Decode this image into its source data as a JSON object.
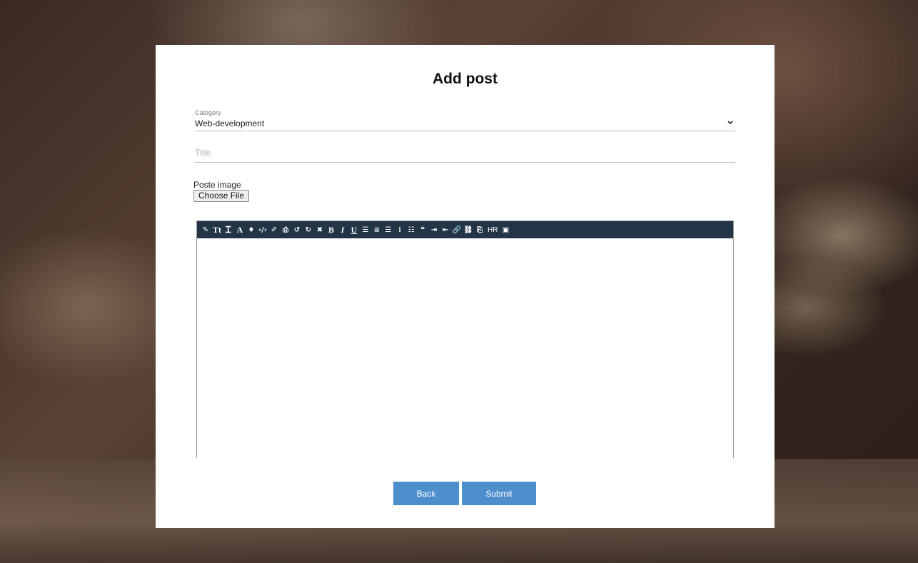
{
  "page": {
    "title": "Add post"
  },
  "form": {
    "category": {
      "label": "Category",
      "value": "Web-development"
    },
    "title": {
      "placeholder": "Title",
      "value": ""
    },
    "image": {
      "label": "Poste image",
      "button_label": "Choose File"
    },
    "editor": {
      "toolbar": [
        {
          "icon": "pencil-icon",
          "glyph": "✎"
        },
        {
          "icon": "font-size-icon",
          "glyph": "Tt"
        },
        {
          "icon": "text-height-icon",
          "glyph": "Ꮖ"
        },
        {
          "icon": "font-icon",
          "glyph": "A"
        },
        {
          "icon": "tint-icon",
          "glyph": "♦"
        },
        {
          "icon": "code-icon",
          "glyph": "‹/›"
        },
        {
          "icon": "eraser-icon",
          "glyph": "✐"
        },
        {
          "icon": "print-icon",
          "glyph": "⎙"
        },
        {
          "icon": "undo-icon",
          "glyph": "↺"
        },
        {
          "icon": "redo-icon",
          "glyph": "↻"
        },
        {
          "icon": "remove-format-icon",
          "glyph": "✖"
        },
        {
          "icon": "bold-icon",
          "glyph": "B"
        },
        {
          "icon": "italic-icon",
          "glyph": "I"
        },
        {
          "icon": "underline-icon",
          "glyph": "U"
        },
        {
          "icon": "align-left-icon",
          "glyph": "☰"
        },
        {
          "icon": "align-center-icon",
          "glyph": "≡"
        },
        {
          "icon": "align-right-icon",
          "glyph": "☰"
        },
        {
          "icon": "ordered-list-icon",
          "glyph": "⁝"
        },
        {
          "icon": "unordered-list-icon",
          "glyph": "☷"
        },
        {
          "icon": "blockquote-icon",
          "glyph": "❝"
        },
        {
          "icon": "indent-icon",
          "glyph": "⇥"
        },
        {
          "icon": "outdent-icon",
          "glyph": "⇤"
        },
        {
          "icon": "link-icon",
          "glyph": "🔗"
        },
        {
          "icon": "unlink-icon",
          "glyph": "⛓"
        },
        {
          "icon": "clipboard-icon",
          "glyph": "⎘"
        },
        {
          "icon": "horizontal-rule-icon",
          "glyph": "HR"
        },
        {
          "icon": "image-icon",
          "glyph": "▣"
        }
      ],
      "content": ""
    }
  },
  "buttons": {
    "back": "Back",
    "submit": "Submit"
  },
  "colors": {
    "toolbar_bg": "#243447",
    "button_bg": "#4d8ecd"
  }
}
